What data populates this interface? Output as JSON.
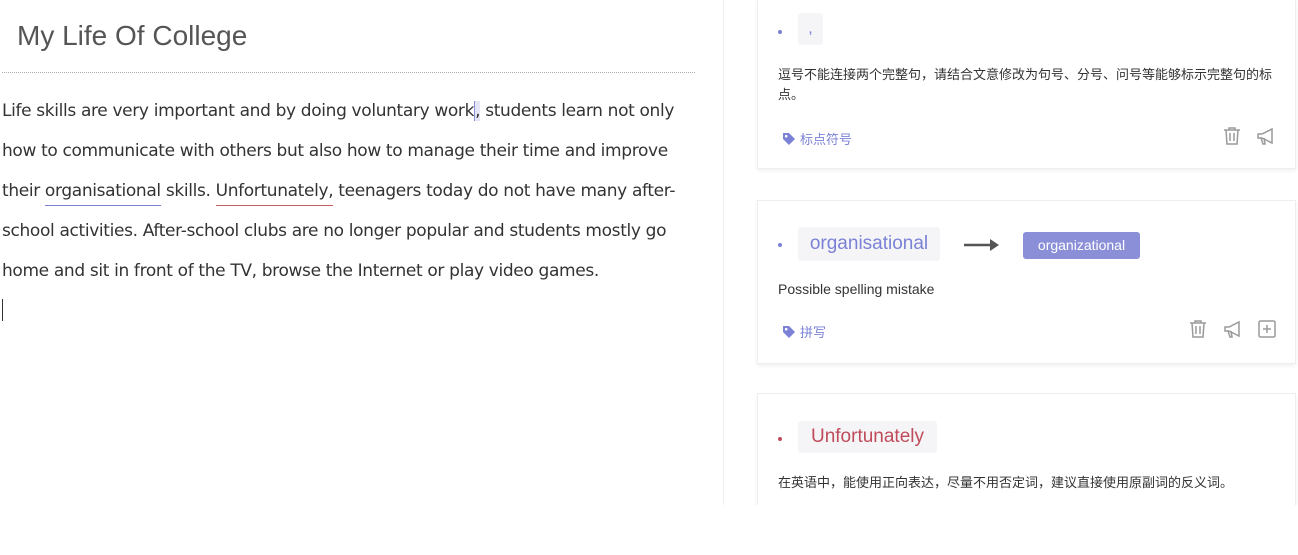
{
  "document": {
    "title": "My Life Of College",
    "body": {
      "p1": "Life skills are very important and by doing voluntary work",
      "comma": ",",
      "p2": " students learn not only how to communicate with others but also how to manage their time and improve their ",
      "word_spelling": "organisational",
      "p3": " skills. ",
      "word_style": "Unfortunately,",
      "p4": " teenagers today do not have many after-school activities. After-school clubs are no longer popular and students mostly go home and sit in front of the TV, browse the Internet or play video games."
    }
  },
  "suggestions": [
    {
      "original": ",",
      "message": "逗号不能连接两个完整句，请结合文意修改为句号、分号、问号等能够标示完整句的标点。",
      "tag": "标点符号",
      "color": "#7b82d6"
    },
    {
      "original": "organisational",
      "replacement": "organizational",
      "message": "Possible spelling mistake",
      "tag": "拼写",
      "color": "#7b82d6"
    },
    {
      "original": "Unfortunately",
      "message": "在英语中，能使用正向表达，尽量不用否定词，建议直接使用原副词的反义词。",
      "color": "#c04b5a"
    }
  ],
  "colors": {
    "accent": "#8a8fd8",
    "accent_text": "#7b82d6",
    "error": "#c04b5a",
    "icon_gray": "#9a9a9a"
  },
  "icons": [
    "tag-icon",
    "trash-icon",
    "megaphone-icon",
    "add-to-dictionary-icon",
    "arrow-right-icon"
  ]
}
